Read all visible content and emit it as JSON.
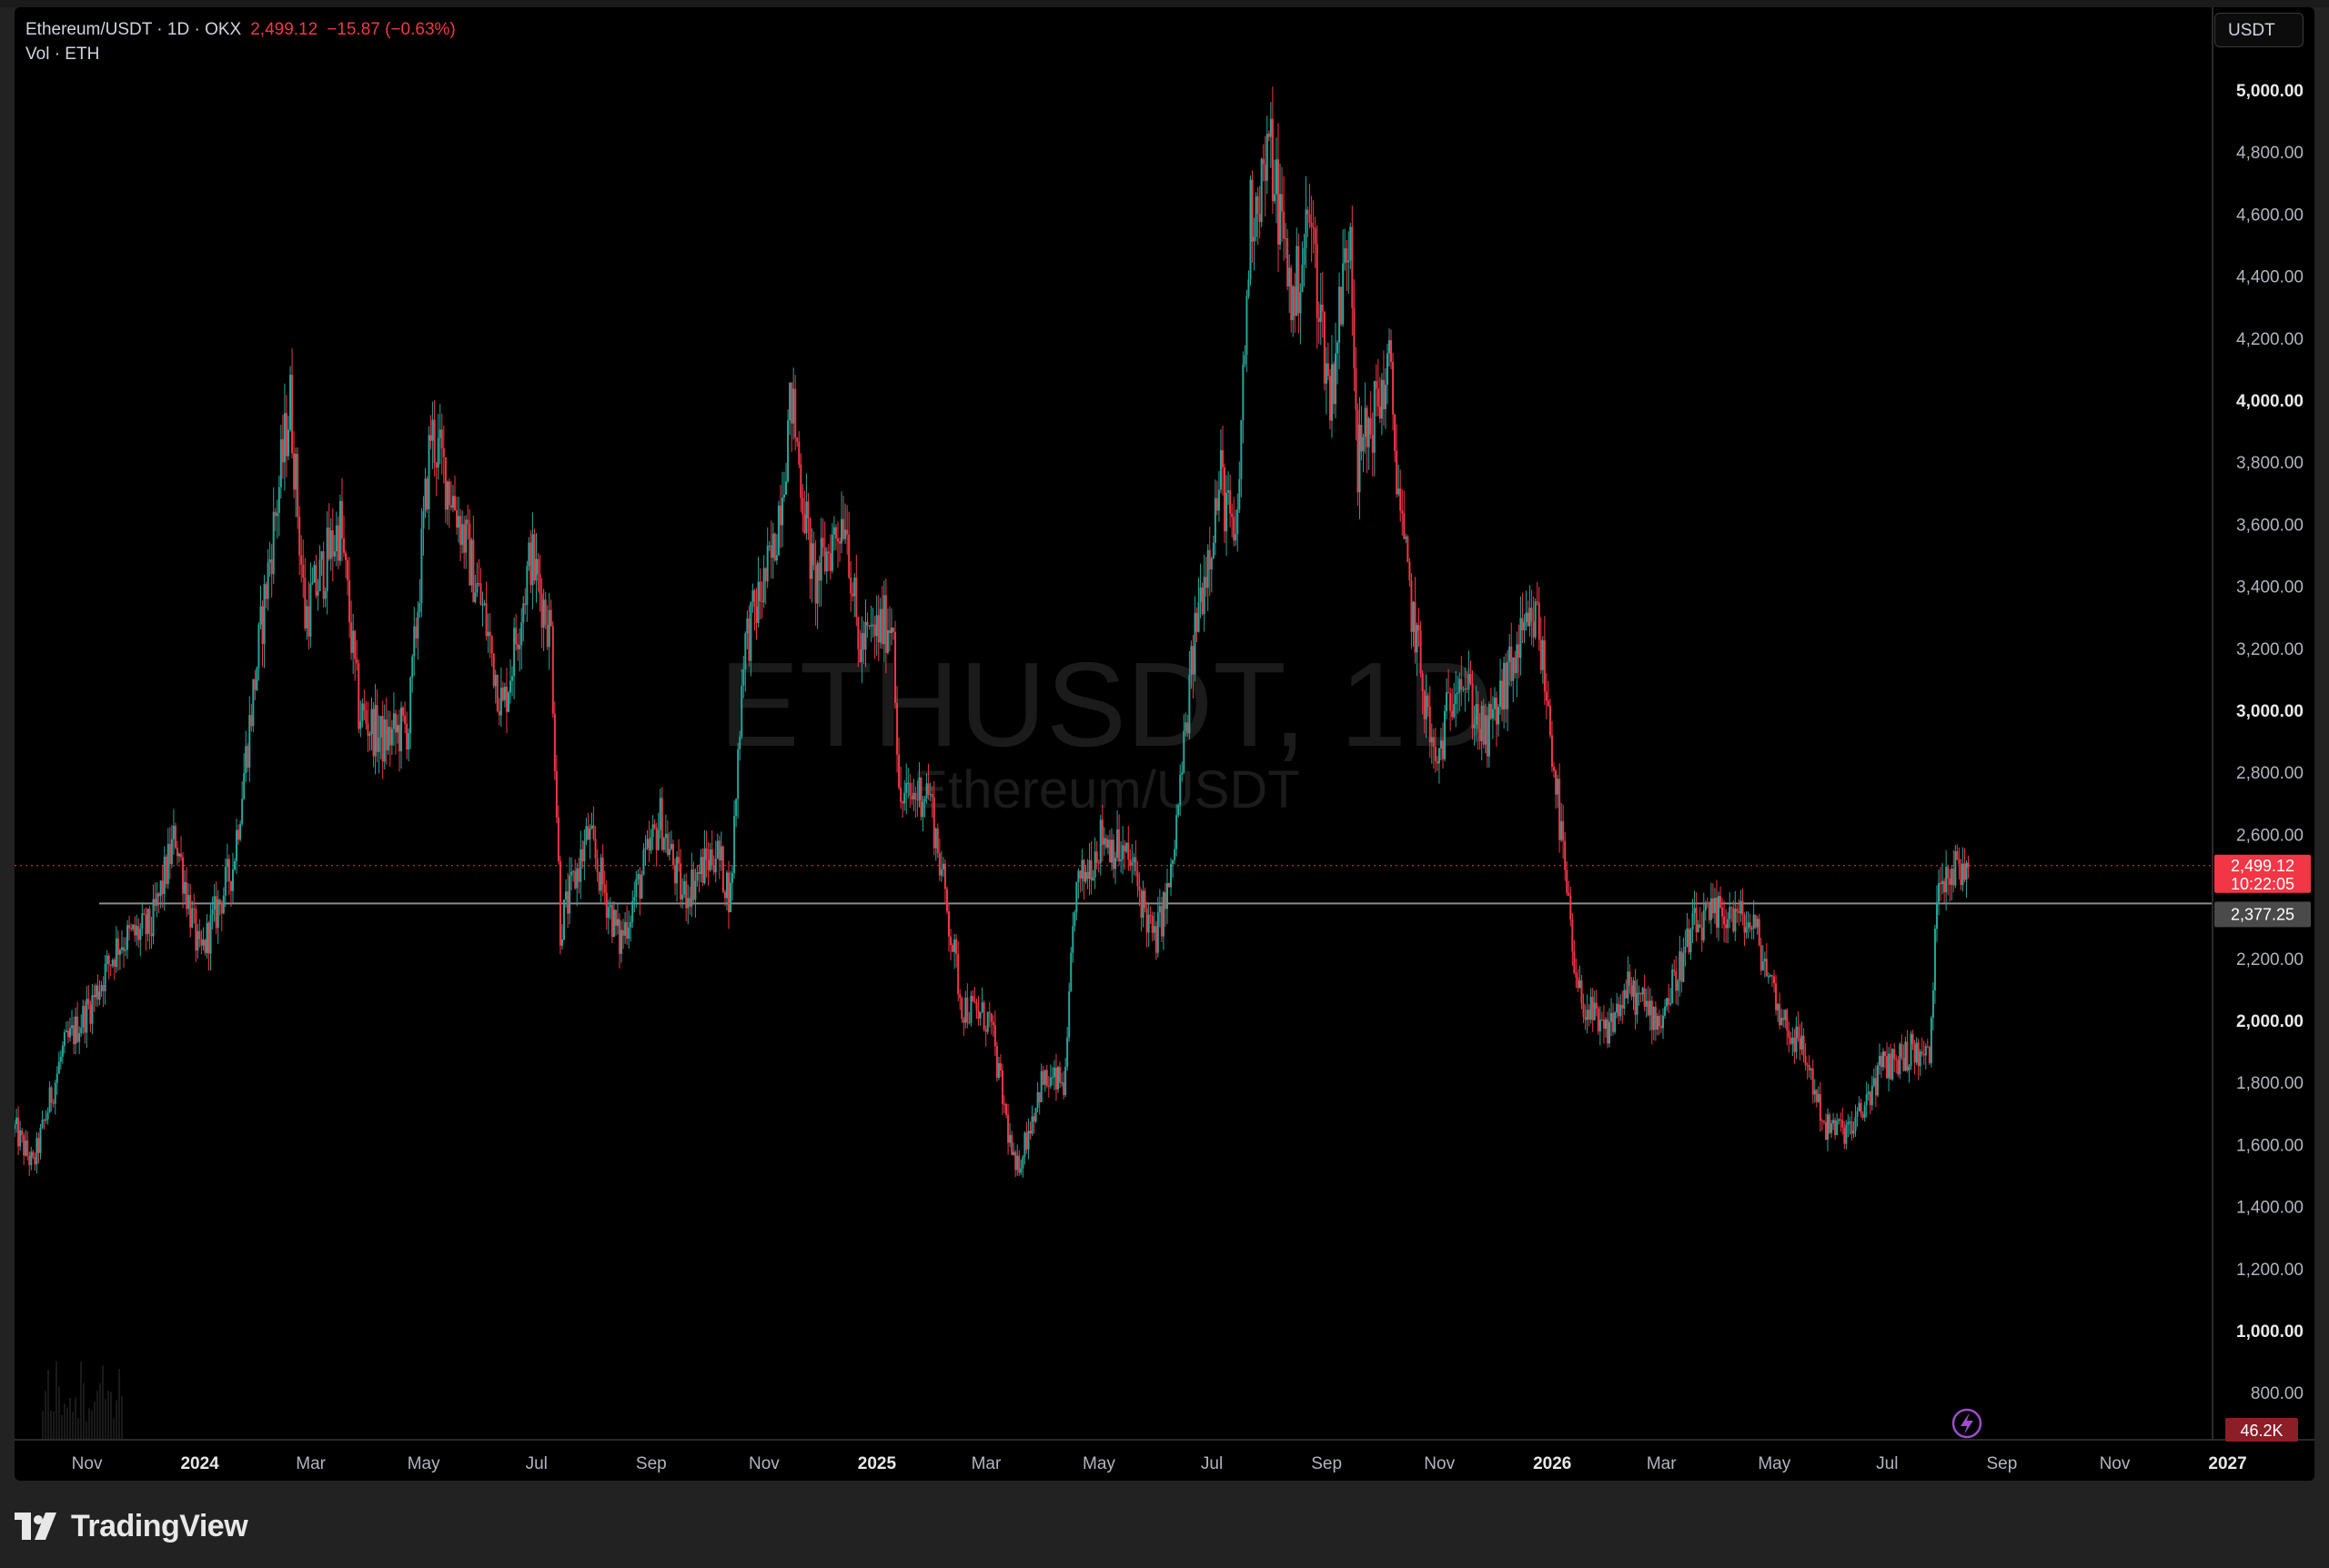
{
  "legend": {
    "symbol": "Ethereum/USDT · 1D · OKX",
    "price": "2,499.12",
    "change": "−15.87 (−0.63%)",
    "volume_label": "Vol · ETH"
  },
  "currency_button": "USDT",
  "watermark": {
    "symbol": "ETHUSDT, 1D",
    "name": "Ethereum/USDT"
  },
  "price_scale": {
    "ticks": [
      "5,000.00",
      "4,800.00",
      "4,600.00",
      "4,400.00",
      "4,200.00",
      "4,000.00",
      "3,800.00",
      "3,600.00",
      "3,400.00",
      "3,200.00",
      "3,000.00",
      "2,800.00",
      "2,600.00",
      "2,200.00",
      "2,000.00",
      "1,800.00",
      "1,600.00",
      "1,400.00",
      "1,200.00",
      "1,000.00",
      "800.00"
    ],
    "last_price_label": "2,499.12",
    "countdown_label": "10:22:05",
    "line_price_label": "2,377.25",
    "volume_label": "46.2K"
  },
  "time_scale": {
    "ticks": [
      "Nov",
      "2024",
      "Mar",
      "May",
      "Jul",
      "Sep",
      "Nov",
      "2025",
      "Mar",
      "May",
      "Jul",
      "Sep",
      "Nov",
      "2026",
      "Mar",
      "May",
      "Jul",
      "Sep",
      "Nov",
      "2027"
    ]
  },
  "colors": {
    "up": "#26a69a",
    "down": "#f23645",
    "background": "#000000",
    "horizontal_line": "#8c8c8c"
  },
  "icons": {
    "replay": "lightning-icon",
    "logo": "tradingview-logo"
  },
  "footer": {
    "brand": "TradingView"
  },
  "chart_data": {
    "type": "candlestick",
    "symbol": "ETHUSDT",
    "interval": "1D",
    "exchange": "OKX",
    "y_range": [
      700,
      5050
    ],
    "x_range": [
      "2023-10-15",
      "2027-01-15"
    ],
    "last_price": 2499.12,
    "horizontal_line": 2377.25,
    "volume_last": "46.2K",
    "anchors": [
      [
        "2023-10-15",
        1650
      ],
      [
        "2023-10-25",
        1530
      ],
      [
        "2023-11-10",
        1900
      ],
      [
        "2023-11-25",
        2050
      ],
      [
        "2023-12-10",
        2250
      ],
      [
        "2023-12-28",
        2300
      ],
      [
        "2024-01-10",
        2600
      ],
      [
        "2024-01-23",
        2200
      ],
      [
        "2024-02-10",
        2500
      ],
      [
        "2024-02-28",
        3400
      ],
      [
        "2024-03-12",
        4000
      ],
      [
        "2024-03-20",
        3300
      ],
      [
        "2024-04-08",
        3600
      ],
      [
        "2024-04-18",
        3000
      ],
      [
        "2024-05-01",
        2900
      ],
      [
        "2024-05-15",
        2950
      ],
      [
        "2024-05-27",
        3900
      ],
      [
        "2024-06-10",
        3650
      ],
      [
        "2024-06-25",
        3300
      ],
      [
        "2024-07-05",
        3000
      ],
      [
        "2024-07-20",
        3500
      ],
      [
        "2024-07-31",
        3250
      ],
      [
        "2024-08-05",
        2300
      ],
      [
        "2024-08-20",
        2600
      ],
      [
        "2024-09-06",
        2250
      ],
      [
        "2024-09-28",
        2650
      ],
      [
        "2024-10-10",
        2400
      ],
      [
        "2024-10-28",
        2550
      ],
      [
        "2024-11-05",
        2400
      ],
      [
        "2024-11-12",
        3200
      ],
      [
        "2024-11-28",
        3500
      ],
      [
        "2024-12-08",
        4000
      ],
      [
        "2024-12-20",
        3400
      ],
      [
        "2025-01-06",
        3650
      ],
      [
        "2025-01-13",
        3200
      ],
      [
        "2025-02-01",
        3300
      ],
      [
        "2025-02-04",
        2700
      ],
      [
        "2025-02-20",
        2750
      ],
      [
        "2025-03-10",
        2050
      ],
      [
        "2025-03-25",
        2000
      ],
      [
        "2025-04-08",
        1500
      ],
      [
        "2025-04-22",
        1800
      ],
      [
        "2025-05-05",
        1800
      ],
      [
        "2025-05-10",
        2400
      ],
      [
        "2025-05-25",
        2600
      ],
      [
        "2025-06-10",
        2500
      ],
      [
        "2025-06-22",
        2250
      ],
      [
        "2025-07-01",
        2450
      ],
      [
        "2025-07-15",
        3300
      ],
      [
        "2025-07-28",
        3750
      ],
      [
        "2025-08-05",
        3500
      ],
      [
        "2025-08-13",
        4600
      ],
      [
        "2025-08-24",
        4800
      ],
      [
        "2025-09-05",
        4300
      ],
      [
        "2025-09-14",
        4600
      ],
      [
        "2025-09-25",
        4000
      ],
      [
        "2025-10-06",
        4600
      ],
      [
        "2025-10-10",
        3800
      ],
      [
        "2025-10-27",
        4100
      ],
      [
        "2025-11-04",
        3500
      ],
      [
        "2025-11-21",
        2800
      ],
      [
        "2025-12-03",
        3150
      ],
      [
        "2025-12-18",
        2900
      ],
      [
        "2026-01-05",
        3200
      ],
      [
        "2026-01-15",
        3300
      ],
      [
        "2026-01-22",
        2950
      ],
      [
        "2026-02-05",
        2100
      ],
      [
        "2026-02-20",
        1950
      ],
      [
        "2026-03-05",
        2100
      ],
      [
        "2026-03-22",
        2000
      ],
      [
        "2026-04-10",
        2300
      ],
      [
        "2026-04-28",
        2350
      ],
      [
        "2026-05-12",
        2300
      ],
      [
        "2026-05-28",
        2000
      ],
      [
        "2026-06-08",
        1900
      ],
      [
        "2026-06-20",
        1650
      ],
      [
        "2026-07-05",
        1650
      ],
      [
        "2026-07-20",
        1850
      ],
      [
        "2026-08-05",
        1900
      ],
      [
        "2026-08-15",
        1880
      ],
      [
        "2026-08-20",
        2480
      ],
      [
        "2026-09-02",
        2490
      ],
      [
        "2026-09-06",
        2499.12
      ]
    ]
  }
}
